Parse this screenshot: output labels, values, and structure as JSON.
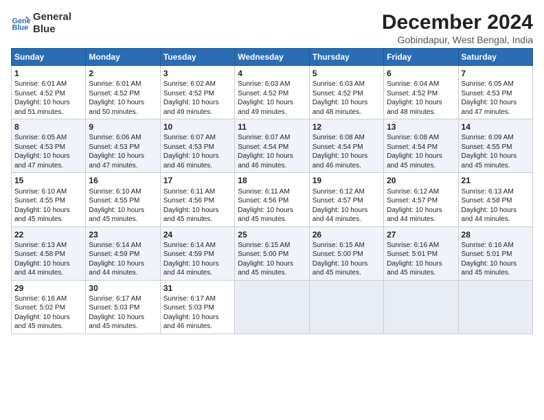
{
  "logo": {
    "line1": "General",
    "line2": "Blue"
  },
  "title": "December 2024",
  "subtitle": "Gobindapur, West Bengal, India",
  "days_of_week": [
    "Sunday",
    "Monday",
    "Tuesday",
    "Wednesday",
    "Thursday",
    "Friday",
    "Saturday"
  ],
  "weeks": [
    [
      {
        "day": "1",
        "info": "Sunrise: 6:01 AM\nSunset: 4:52 PM\nDaylight: 10 hours\nand 51 minutes."
      },
      {
        "day": "2",
        "info": "Sunrise: 6:01 AM\nSunset: 4:52 PM\nDaylight: 10 hours\nand 50 minutes."
      },
      {
        "day": "3",
        "info": "Sunrise: 6:02 AM\nSunset: 4:52 PM\nDaylight: 10 hours\nand 49 minutes."
      },
      {
        "day": "4",
        "info": "Sunrise: 6:03 AM\nSunset: 4:52 PM\nDaylight: 10 hours\nand 49 minutes."
      },
      {
        "day": "5",
        "info": "Sunrise: 6:03 AM\nSunset: 4:52 PM\nDaylight: 10 hours\nand 48 minutes."
      },
      {
        "day": "6",
        "info": "Sunrise: 6:04 AM\nSunset: 4:52 PM\nDaylight: 10 hours\nand 48 minutes."
      },
      {
        "day": "7",
        "info": "Sunrise: 6:05 AM\nSunset: 4:53 PM\nDaylight: 10 hours\nand 47 minutes."
      }
    ],
    [
      {
        "day": "8",
        "info": "Sunrise: 6:05 AM\nSunset: 4:53 PM\nDaylight: 10 hours\nand 47 minutes."
      },
      {
        "day": "9",
        "info": "Sunrise: 6:06 AM\nSunset: 4:53 PM\nDaylight: 10 hours\nand 47 minutes."
      },
      {
        "day": "10",
        "info": "Sunrise: 6:07 AM\nSunset: 4:53 PM\nDaylight: 10 hours\nand 46 minutes."
      },
      {
        "day": "11",
        "info": "Sunrise: 6:07 AM\nSunset: 4:54 PM\nDaylight: 10 hours\nand 46 minutes."
      },
      {
        "day": "12",
        "info": "Sunrise: 6:08 AM\nSunset: 4:54 PM\nDaylight: 10 hours\nand 46 minutes."
      },
      {
        "day": "13",
        "info": "Sunrise: 6:08 AM\nSunset: 4:54 PM\nDaylight: 10 hours\nand 45 minutes."
      },
      {
        "day": "14",
        "info": "Sunrise: 6:09 AM\nSunset: 4:55 PM\nDaylight: 10 hours\nand 45 minutes."
      }
    ],
    [
      {
        "day": "15",
        "info": "Sunrise: 6:10 AM\nSunset: 4:55 PM\nDaylight: 10 hours\nand 45 minutes."
      },
      {
        "day": "16",
        "info": "Sunrise: 6:10 AM\nSunset: 4:55 PM\nDaylight: 10 hours\nand 45 minutes."
      },
      {
        "day": "17",
        "info": "Sunrise: 6:11 AM\nSunset: 4:56 PM\nDaylight: 10 hours\nand 45 minutes."
      },
      {
        "day": "18",
        "info": "Sunrise: 6:11 AM\nSunset: 4:56 PM\nDaylight: 10 hours\nand 45 minutes."
      },
      {
        "day": "19",
        "info": "Sunrise: 6:12 AM\nSunset: 4:57 PM\nDaylight: 10 hours\nand 44 minutes."
      },
      {
        "day": "20",
        "info": "Sunrise: 6:12 AM\nSunset: 4:57 PM\nDaylight: 10 hours\nand 44 minutes."
      },
      {
        "day": "21",
        "info": "Sunrise: 6:13 AM\nSunset: 4:58 PM\nDaylight: 10 hours\nand 44 minutes."
      }
    ],
    [
      {
        "day": "22",
        "info": "Sunrise: 6:13 AM\nSunset: 4:58 PM\nDaylight: 10 hours\nand 44 minutes."
      },
      {
        "day": "23",
        "info": "Sunrise: 6:14 AM\nSunset: 4:59 PM\nDaylight: 10 hours\nand 44 minutes."
      },
      {
        "day": "24",
        "info": "Sunrise: 6:14 AM\nSunset: 4:59 PM\nDaylight: 10 hours\nand 44 minutes."
      },
      {
        "day": "25",
        "info": "Sunrise: 6:15 AM\nSunset: 5:00 PM\nDaylight: 10 hours\nand 45 minutes."
      },
      {
        "day": "26",
        "info": "Sunrise: 6:15 AM\nSunset: 5:00 PM\nDaylight: 10 hours\nand 45 minutes."
      },
      {
        "day": "27",
        "info": "Sunrise: 6:16 AM\nSunset: 5:01 PM\nDaylight: 10 hours\nand 45 minutes."
      },
      {
        "day": "28",
        "info": "Sunrise: 6:16 AM\nSunset: 5:01 PM\nDaylight: 10 hours\nand 45 minutes."
      }
    ],
    [
      {
        "day": "29",
        "info": "Sunrise: 6:16 AM\nSunset: 5:02 PM\nDaylight: 10 hours\nand 45 minutes."
      },
      {
        "day": "30",
        "info": "Sunrise: 6:17 AM\nSunset: 5:03 PM\nDaylight: 10 hours\nand 45 minutes."
      },
      {
        "day": "31",
        "info": "Sunrise: 6:17 AM\nSunset: 5:03 PM\nDaylight: 10 hours\nand 46 minutes."
      },
      {
        "day": "",
        "info": ""
      },
      {
        "day": "",
        "info": ""
      },
      {
        "day": "",
        "info": ""
      },
      {
        "day": "",
        "info": ""
      }
    ]
  ]
}
